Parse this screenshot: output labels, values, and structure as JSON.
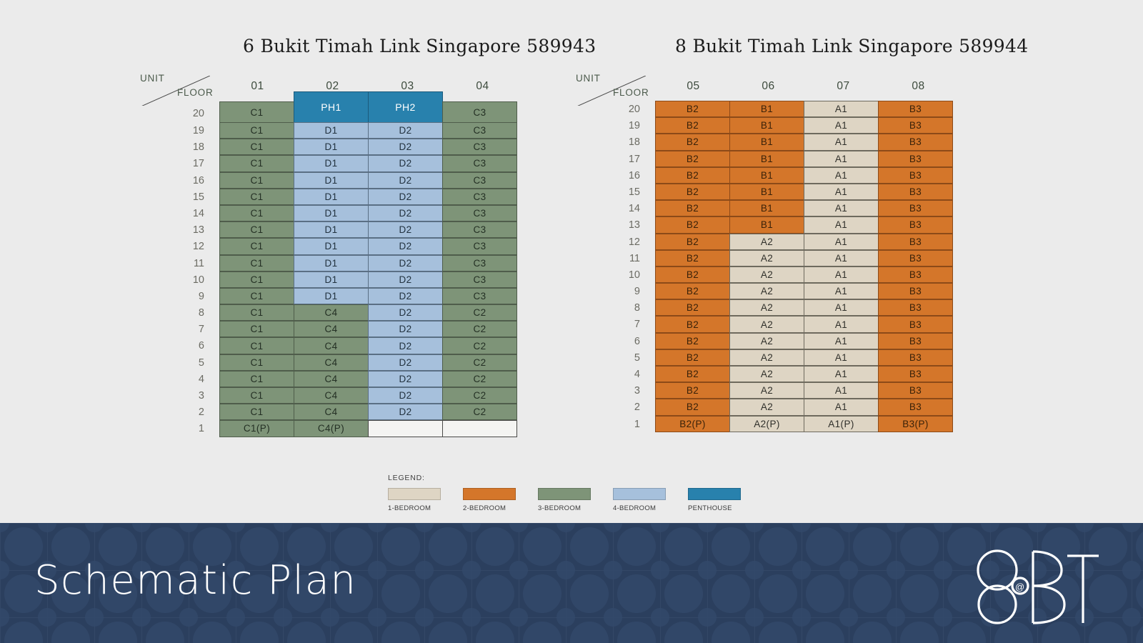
{
  "blocks": [
    {
      "title": "6 Bukit Timah Link Singapore 589943",
      "corner": {
        "unit": "UNIT",
        "floor": "FLOOR"
      },
      "columns": [
        "01",
        "02",
        "03",
        "04"
      ],
      "floors": [
        "20",
        "19",
        "18",
        "17",
        "16",
        "15",
        "14",
        "13",
        "12",
        "11",
        "10",
        "9",
        "8",
        "7",
        "6",
        "5",
        "4",
        "3",
        "2",
        "1"
      ],
      "rows": [
        {
          "floor": "20",
          "cells": [
            {
              "label": "C1",
              "type": "green"
            },
            {
              "label": "PH1",
              "type": "penthouse"
            },
            {
              "label": "PH2",
              "type": "penthouse"
            },
            {
              "label": "C3",
              "type": "green"
            }
          ]
        },
        {
          "floor": "19",
          "cells": [
            {
              "label": "C1",
              "type": "green"
            },
            {
              "label": "D1",
              "type": "blue"
            },
            {
              "label": "D2",
              "type": "blue"
            },
            {
              "label": "C3",
              "type": "green"
            }
          ]
        },
        {
          "floor": "18",
          "cells": [
            {
              "label": "C1",
              "type": "green"
            },
            {
              "label": "D1",
              "type": "blue"
            },
            {
              "label": "D2",
              "type": "blue"
            },
            {
              "label": "C3",
              "type": "green"
            }
          ]
        },
        {
          "floor": "17",
          "cells": [
            {
              "label": "C1",
              "type": "green"
            },
            {
              "label": "D1",
              "type": "blue"
            },
            {
              "label": "D2",
              "type": "blue"
            },
            {
              "label": "C3",
              "type": "green"
            }
          ]
        },
        {
          "floor": "16",
          "cells": [
            {
              "label": "C1",
              "type": "green"
            },
            {
              "label": "D1",
              "type": "blue"
            },
            {
              "label": "D2",
              "type": "blue"
            },
            {
              "label": "C3",
              "type": "green"
            }
          ]
        },
        {
          "floor": "15",
          "cells": [
            {
              "label": "C1",
              "type": "green"
            },
            {
              "label": "D1",
              "type": "blue"
            },
            {
              "label": "D2",
              "type": "blue"
            },
            {
              "label": "C3",
              "type": "green"
            }
          ]
        },
        {
          "floor": "14",
          "cells": [
            {
              "label": "C1",
              "type": "green"
            },
            {
              "label": "D1",
              "type": "blue"
            },
            {
              "label": "D2",
              "type": "blue"
            },
            {
              "label": "C3",
              "type": "green"
            }
          ]
        },
        {
          "floor": "13",
          "cells": [
            {
              "label": "C1",
              "type": "green"
            },
            {
              "label": "D1",
              "type": "blue"
            },
            {
              "label": "D2",
              "type": "blue"
            },
            {
              "label": "C3",
              "type": "green"
            }
          ]
        },
        {
          "floor": "12",
          "cells": [
            {
              "label": "C1",
              "type": "green"
            },
            {
              "label": "D1",
              "type": "blue"
            },
            {
              "label": "D2",
              "type": "blue"
            },
            {
              "label": "C3",
              "type": "green"
            }
          ]
        },
        {
          "floor": "11",
          "cells": [
            {
              "label": "C1",
              "type": "green"
            },
            {
              "label": "D1",
              "type": "blue"
            },
            {
              "label": "D2",
              "type": "blue"
            },
            {
              "label": "C3",
              "type": "green"
            }
          ]
        },
        {
          "floor": "10",
          "cells": [
            {
              "label": "C1",
              "type": "green"
            },
            {
              "label": "D1",
              "type": "blue"
            },
            {
              "label": "D2",
              "type": "blue"
            },
            {
              "label": "C3",
              "type": "green"
            }
          ]
        },
        {
          "floor": "9",
          "cells": [
            {
              "label": "C1",
              "type": "green"
            },
            {
              "label": "D1",
              "type": "blue"
            },
            {
              "label": "D2",
              "type": "blue"
            },
            {
              "label": "C3",
              "type": "green"
            }
          ]
        },
        {
          "floor": "8",
          "cells": [
            {
              "label": "C1",
              "type": "green"
            },
            {
              "label": "C4",
              "type": "green"
            },
            {
              "label": "D2",
              "type": "blue"
            },
            {
              "label": "C2",
              "type": "green"
            }
          ]
        },
        {
          "floor": "7",
          "cells": [
            {
              "label": "C1",
              "type": "green"
            },
            {
              "label": "C4",
              "type": "green"
            },
            {
              "label": "D2",
              "type": "blue"
            },
            {
              "label": "C2",
              "type": "green"
            }
          ]
        },
        {
          "floor": "6",
          "cells": [
            {
              "label": "C1",
              "type": "green"
            },
            {
              "label": "C4",
              "type": "green"
            },
            {
              "label": "D2",
              "type": "blue"
            },
            {
              "label": "C2",
              "type": "green"
            }
          ]
        },
        {
          "floor": "5",
          "cells": [
            {
              "label": "C1",
              "type": "green"
            },
            {
              "label": "C4",
              "type": "green"
            },
            {
              "label": "D2",
              "type": "blue"
            },
            {
              "label": "C2",
              "type": "green"
            }
          ]
        },
        {
          "floor": "4",
          "cells": [
            {
              "label": "C1",
              "type": "green"
            },
            {
              "label": "C4",
              "type": "green"
            },
            {
              "label": "D2",
              "type": "blue"
            },
            {
              "label": "C2",
              "type": "green"
            }
          ]
        },
        {
          "floor": "3",
          "cells": [
            {
              "label": "C1",
              "type": "green"
            },
            {
              "label": "C4",
              "type": "green"
            },
            {
              "label": "D2",
              "type": "blue"
            },
            {
              "label": "C2",
              "type": "green"
            }
          ]
        },
        {
          "floor": "2",
          "cells": [
            {
              "label": "C1",
              "type": "green"
            },
            {
              "label": "C4",
              "type": "green"
            },
            {
              "label": "D2",
              "type": "blue"
            },
            {
              "label": "C2",
              "type": "green"
            }
          ]
        },
        {
          "floor": "1",
          "cells": [
            {
              "label": "C1(P)",
              "type": "green"
            },
            {
              "label": "C4(P)",
              "type": "green"
            },
            {
              "label": "",
              "type": "empty"
            },
            {
              "label": "",
              "type": "empty"
            }
          ]
        }
      ]
    },
    {
      "title": "8 Bukit Timah Link Singapore 589944",
      "corner": {
        "unit": "UNIT",
        "floor": "FLOOR"
      },
      "columns": [
        "05",
        "06",
        "07",
        "08"
      ],
      "floors": [
        "20",
        "19",
        "18",
        "17",
        "16",
        "15",
        "14",
        "13",
        "12",
        "11",
        "10",
        "9",
        "8",
        "7",
        "6",
        "5",
        "4",
        "3",
        "2",
        "1"
      ],
      "rows": [
        {
          "floor": "20",
          "cells": [
            {
              "label": "B2",
              "type": "orange"
            },
            {
              "label": "B1",
              "type": "orange"
            },
            {
              "label": "A1",
              "type": "beige"
            },
            {
              "label": "B3",
              "type": "orange"
            }
          ]
        },
        {
          "floor": "19",
          "cells": [
            {
              "label": "B2",
              "type": "orange"
            },
            {
              "label": "B1",
              "type": "orange"
            },
            {
              "label": "A1",
              "type": "beige"
            },
            {
              "label": "B3",
              "type": "orange"
            }
          ]
        },
        {
          "floor": "18",
          "cells": [
            {
              "label": "B2",
              "type": "orange"
            },
            {
              "label": "B1",
              "type": "orange"
            },
            {
              "label": "A1",
              "type": "beige"
            },
            {
              "label": "B3",
              "type": "orange"
            }
          ]
        },
        {
          "floor": "17",
          "cells": [
            {
              "label": "B2",
              "type": "orange"
            },
            {
              "label": "B1",
              "type": "orange"
            },
            {
              "label": "A1",
              "type": "beige"
            },
            {
              "label": "B3",
              "type": "orange"
            }
          ]
        },
        {
          "floor": "16",
          "cells": [
            {
              "label": "B2",
              "type": "orange"
            },
            {
              "label": "B1",
              "type": "orange"
            },
            {
              "label": "A1",
              "type": "beige"
            },
            {
              "label": "B3",
              "type": "orange"
            }
          ]
        },
        {
          "floor": "15",
          "cells": [
            {
              "label": "B2",
              "type": "orange"
            },
            {
              "label": "B1",
              "type": "orange"
            },
            {
              "label": "A1",
              "type": "beige"
            },
            {
              "label": "B3",
              "type": "orange"
            }
          ]
        },
        {
          "floor": "14",
          "cells": [
            {
              "label": "B2",
              "type": "orange"
            },
            {
              "label": "B1",
              "type": "orange"
            },
            {
              "label": "A1",
              "type": "beige"
            },
            {
              "label": "B3",
              "type": "orange"
            }
          ]
        },
        {
          "floor": "13",
          "cells": [
            {
              "label": "B2",
              "type": "orange"
            },
            {
              "label": "B1",
              "type": "orange"
            },
            {
              "label": "A1",
              "type": "beige"
            },
            {
              "label": "B3",
              "type": "orange"
            }
          ]
        },
        {
          "floor": "12",
          "cells": [
            {
              "label": "B2",
              "type": "orange"
            },
            {
              "label": "A2",
              "type": "beige"
            },
            {
              "label": "A1",
              "type": "beige"
            },
            {
              "label": "B3",
              "type": "orange"
            }
          ]
        },
        {
          "floor": "11",
          "cells": [
            {
              "label": "B2",
              "type": "orange"
            },
            {
              "label": "A2",
              "type": "beige"
            },
            {
              "label": "A1",
              "type": "beige"
            },
            {
              "label": "B3",
              "type": "orange"
            }
          ]
        },
        {
          "floor": "10",
          "cells": [
            {
              "label": "B2",
              "type": "orange"
            },
            {
              "label": "A2",
              "type": "beige"
            },
            {
              "label": "A1",
              "type": "beige"
            },
            {
              "label": "B3",
              "type": "orange"
            }
          ]
        },
        {
          "floor": "9",
          "cells": [
            {
              "label": "B2",
              "type": "orange"
            },
            {
              "label": "A2",
              "type": "beige"
            },
            {
              "label": "A1",
              "type": "beige"
            },
            {
              "label": "B3",
              "type": "orange"
            }
          ]
        },
        {
          "floor": "8",
          "cells": [
            {
              "label": "B2",
              "type": "orange"
            },
            {
              "label": "A2",
              "type": "beige"
            },
            {
              "label": "A1",
              "type": "beige"
            },
            {
              "label": "B3",
              "type": "orange"
            }
          ]
        },
        {
          "floor": "7",
          "cells": [
            {
              "label": "B2",
              "type": "orange"
            },
            {
              "label": "A2",
              "type": "beige"
            },
            {
              "label": "A1",
              "type": "beige"
            },
            {
              "label": "B3",
              "type": "orange"
            }
          ]
        },
        {
          "floor": "6",
          "cells": [
            {
              "label": "B2",
              "type": "orange"
            },
            {
              "label": "A2",
              "type": "beige"
            },
            {
              "label": "A1",
              "type": "beige"
            },
            {
              "label": "B3",
              "type": "orange"
            }
          ]
        },
        {
          "floor": "5",
          "cells": [
            {
              "label": "B2",
              "type": "orange"
            },
            {
              "label": "A2",
              "type": "beige"
            },
            {
              "label": "A1",
              "type": "beige"
            },
            {
              "label": "B3",
              "type": "orange"
            }
          ]
        },
        {
          "floor": "4",
          "cells": [
            {
              "label": "B2",
              "type": "orange"
            },
            {
              "label": "A2",
              "type": "beige"
            },
            {
              "label": "A1",
              "type": "beige"
            },
            {
              "label": "B3",
              "type": "orange"
            }
          ]
        },
        {
          "floor": "3",
          "cells": [
            {
              "label": "B2",
              "type": "orange"
            },
            {
              "label": "A2",
              "type": "beige"
            },
            {
              "label": "A1",
              "type": "beige"
            },
            {
              "label": "B3",
              "type": "orange"
            }
          ]
        },
        {
          "floor": "2",
          "cells": [
            {
              "label": "B2",
              "type": "orange"
            },
            {
              "label": "A2",
              "type": "beige"
            },
            {
              "label": "A1",
              "type": "beige"
            },
            {
              "label": "B3",
              "type": "orange"
            }
          ]
        },
        {
          "floor": "1",
          "cells": [
            {
              "label": "B2(P)",
              "type": "orange"
            },
            {
              "label": "A2(P)",
              "type": "beige"
            },
            {
              "label": "A1(P)",
              "type": "beige"
            },
            {
              "label": "B3(P)",
              "type": "orange"
            }
          ]
        }
      ]
    }
  ],
  "legend": {
    "title": "LEGEND:",
    "items": [
      {
        "label": "1-BEDROOM",
        "type": "beige",
        "color": "#ded5c4"
      },
      {
        "label": "2-BEDROOM",
        "type": "orange",
        "color": "#d4762a"
      },
      {
        "label": "3-BEDROOM",
        "type": "green",
        "color": "#7e9478"
      },
      {
        "label": "4-BEDROOM",
        "type": "blue",
        "color": "#a6c0dc"
      },
      {
        "label": "PENTHOUSE",
        "type": "penthouse",
        "color": "#2881ad"
      }
    ]
  },
  "footer": {
    "title": "Schematic Plan",
    "logo_text": "8@BT",
    "background_color": "#2b3f5e"
  }
}
